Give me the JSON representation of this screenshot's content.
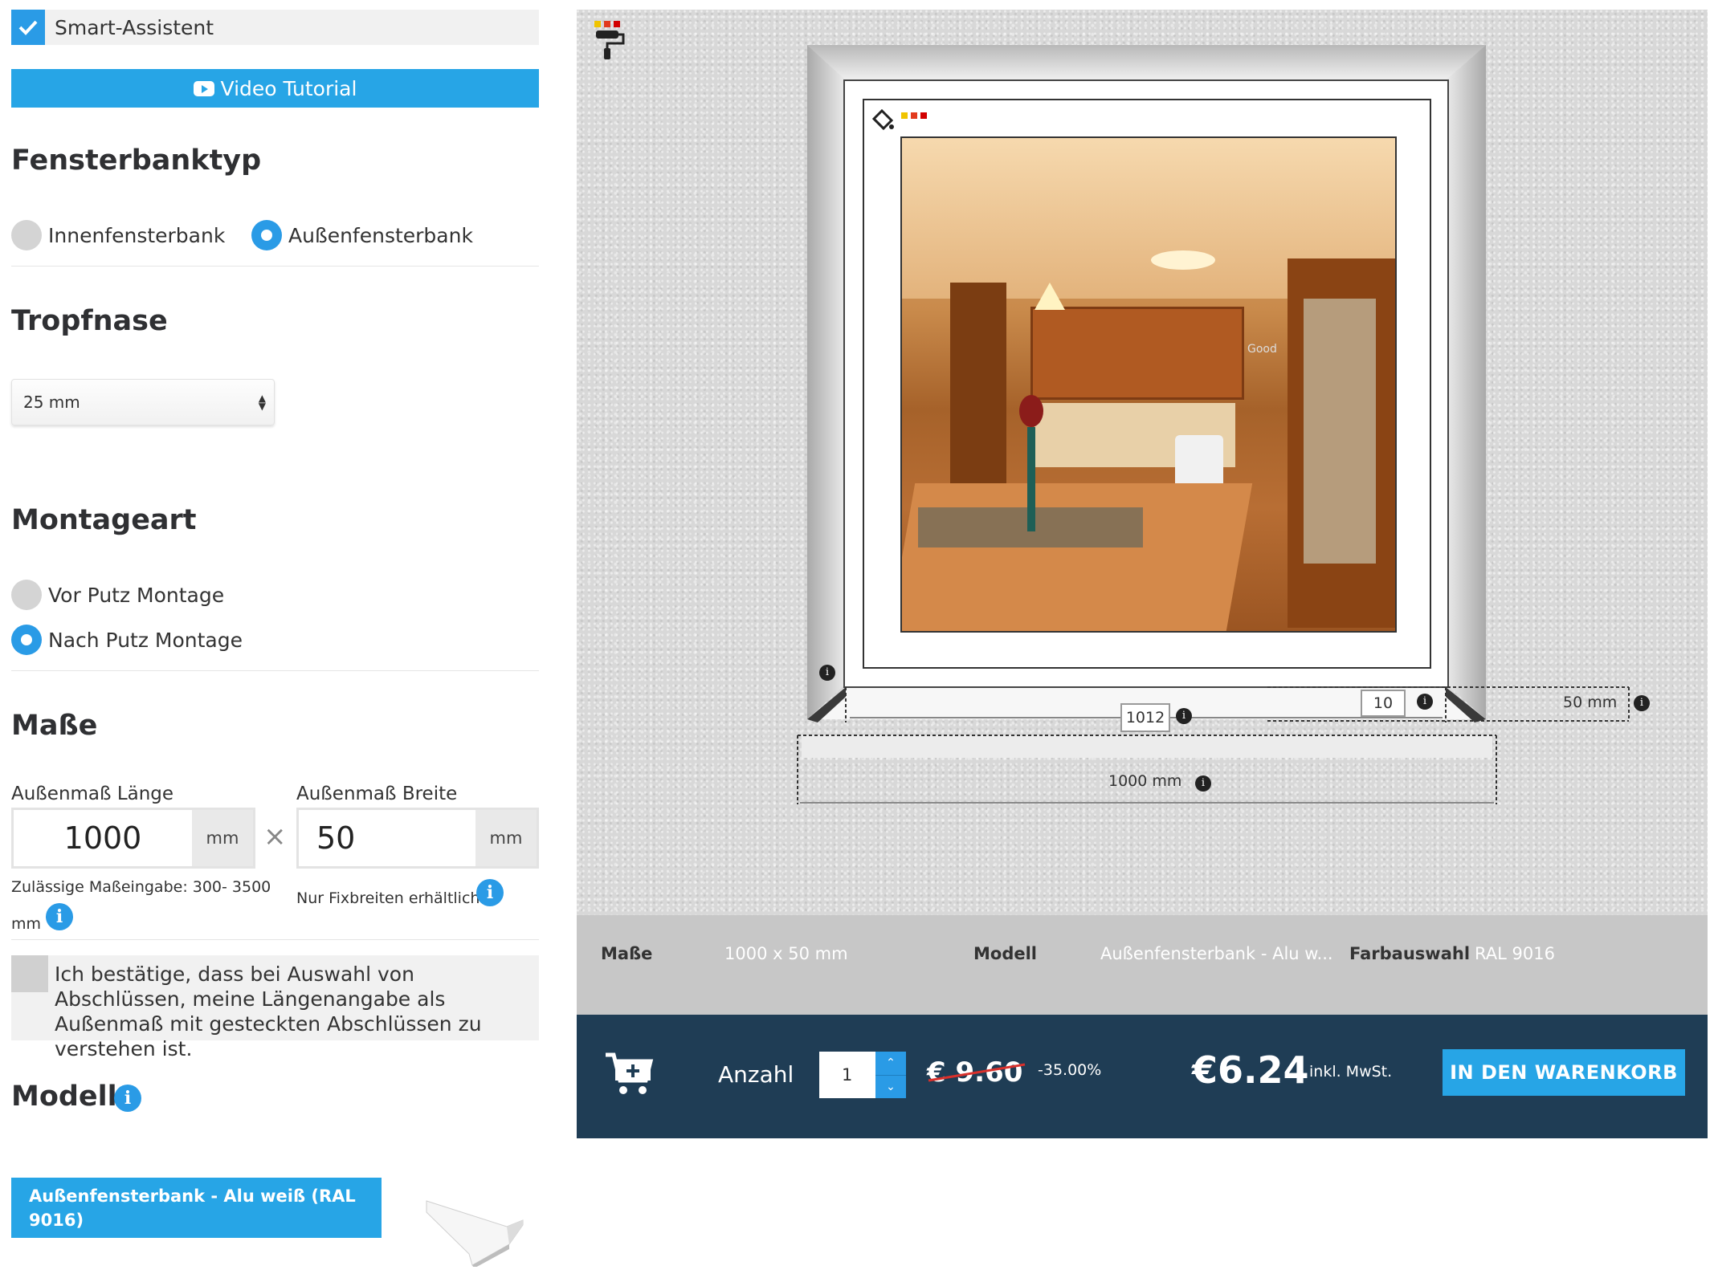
{
  "smart_assistant": {
    "label": "Smart-Assistent",
    "checked": true
  },
  "video_button": {
    "label": "Video Tutorial"
  },
  "sill_type": {
    "heading": "Fensterbanktyp",
    "options": [
      {
        "label": "Innenfensterbank",
        "selected": false
      },
      {
        "label": "Außenfensterbank",
        "selected": true
      }
    ]
  },
  "drip_edge": {
    "heading": "Tropfnase",
    "selected": "25 mm"
  },
  "mounting": {
    "heading": "Montageart",
    "options": [
      {
        "label": "Vor Putz Montage",
        "selected": false
      },
      {
        "label": "Nach Putz Montage",
        "selected": true
      }
    ]
  },
  "dimensions": {
    "heading": "Maße",
    "length": {
      "label": "Außenmaß Länge",
      "value": "1000",
      "unit": "mm",
      "hint": "Zulässige Maßeingabe: 300- 3500",
      "hint2": "mm"
    },
    "times": "×",
    "width": {
      "label": "Außenmaß Breite",
      "value": "50",
      "unit": "mm",
      "hint": "Nur Fixbreiten erhältlich"
    }
  },
  "confirm": {
    "text": "Ich bestätige, dass bei Auswahl von Abschlüssen, meine Längenangabe als Außenmaß mit gesteckten Abschlüssen zu verstehen ist."
  },
  "model": {
    "heading": "Modell",
    "button": "Außenfensterbank - Alu weiß (RAL 9016)"
  },
  "preview": {
    "inner_length": "1012",
    "depth_marker": "10",
    "width_label": "50 mm",
    "length_label": "1000 mm",
    "photo_text": "Good"
  },
  "summary": {
    "dims_key": "Maße",
    "dims_val": "1000 x 50 mm",
    "model_key": "Modell",
    "model_val": "Außenfensterbank - Alu w...",
    "color_key": "Farbauswahl",
    "color_val": "RAL 9016"
  },
  "buy": {
    "qty_label": "Anzahl",
    "qty": "1",
    "old_price": "€ 9.60",
    "discount": "-35.00%",
    "price": "€6.24",
    "tax": "inkl. MwSt.",
    "button": "IN DEN WARENKORB"
  },
  "colors": {
    "accent": "#2a9be6",
    "buybar": "#1f3d55",
    "infobar": "#c7c7c7"
  }
}
